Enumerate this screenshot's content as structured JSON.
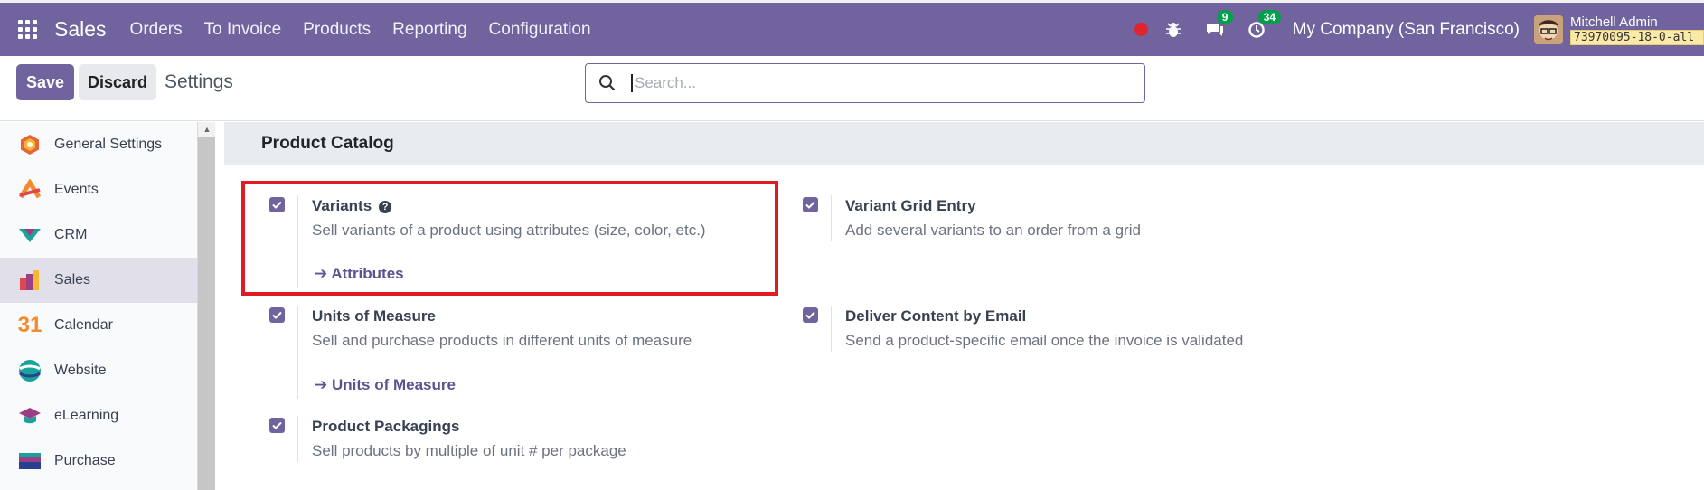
{
  "navbar": {
    "brand": "Sales",
    "menu": [
      "Orders",
      "To Invoice",
      "Products",
      "Reporting",
      "Configuration"
    ],
    "messages_badge": "9",
    "activities_badge": "34",
    "company": "My Company (San Francisco)",
    "user_name": "Mitchell Admin",
    "database": "73970095-18-0-all"
  },
  "control": {
    "save_label": "Save",
    "discard_label": "Discard",
    "title": "Settings",
    "search_placeholder": "Search..."
  },
  "sidebar": {
    "items": [
      {
        "label": "General Settings",
        "icon": "general-settings-icon"
      },
      {
        "label": "Events",
        "icon": "events-icon"
      },
      {
        "label": "CRM",
        "icon": "crm-icon"
      },
      {
        "label": "Sales",
        "icon": "sales-icon"
      },
      {
        "label": "Calendar",
        "icon": "calendar-icon"
      },
      {
        "label": "Website",
        "icon": "website-icon"
      },
      {
        "label": "eLearning",
        "icon": "elearning-icon"
      },
      {
        "label": "Purchase",
        "icon": "purchase-icon"
      }
    ],
    "calendar_icon_text": "31"
  },
  "section": {
    "title": "Product Catalog",
    "settings": {
      "variants": {
        "title": "Variants",
        "desc": "Sell variants of a product using attributes (size, color, etc.)",
        "link": "Attributes",
        "checked": true
      },
      "grid": {
        "title": "Variant Grid Entry",
        "desc": "Add several variants to an order from a grid",
        "checked": true
      },
      "uom": {
        "title": "Units of Measure",
        "desc": "Sell and purchase products in different units of measure",
        "link": "Units of Measure",
        "checked": true
      },
      "deliver": {
        "title": "Deliver Content by Email",
        "desc": "Send a product-specific email once the invoice is validated",
        "checked": true
      },
      "packaging": {
        "title": "Product Packagings",
        "desc": "Sell products by multiple of unit # per package",
        "checked": true
      }
    }
  },
  "colors": {
    "brand": "#71639e",
    "highlight": "#e01b24",
    "link": "#5e5190"
  }
}
